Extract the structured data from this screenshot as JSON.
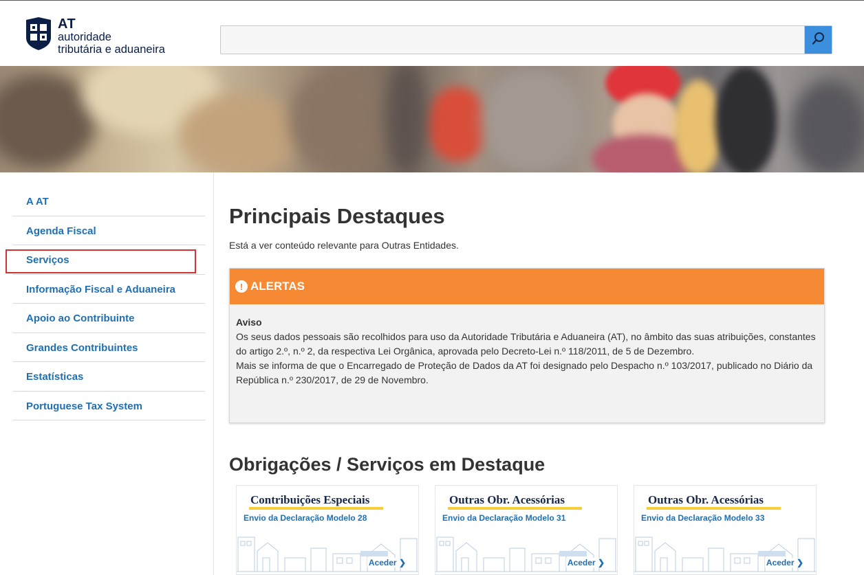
{
  "brand": {
    "logo_abbr": "AT",
    "logo_line1": "autoridade",
    "logo_line2": "tributária e aduaneira",
    "colors": {
      "primary": "#1f6fb2",
      "alert_orange": "#f68a34",
      "search_button": "#3b8fdc",
      "highlight_red": "#d23232"
    }
  },
  "search": {
    "value": "",
    "placeholder": "",
    "button_icon": "search-icon"
  },
  "sidebar": {
    "items": [
      {
        "label": "A AT"
      },
      {
        "label": "Agenda Fiscal"
      },
      {
        "label": "Serviços"
      },
      {
        "label": "Informação Fiscal e Aduaneira"
      },
      {
        "label": "Apoio ao Contribuinte"
      },
      {
        "label": "Grandes Contribuintes"
      },
      {
        "label": "Estatísticas"
      },
      {
        "label": "Portuguese Tax System"
      }
    ]
  },
  "main": {
    "title": "Principais Destaques",
    "subtitle": "Está a ver conteúdo relevante para Outras Entidades.",
    "alert": {
      "heading": "ALERTAS",
      "icon": "exclamation-icon",
      "aviso_label": "Aviso",
      "paragraph1": "Os seus dados pessoais são recolhidos para uso da Autoridade Tributária e Aduaneira (AT), no âmbito das suas atribuições, constantes do artigo 2.º, n.º 2, da respectiva Lei Orgânica, aprovada pelo Decreto-Lei n.º 118/2011, de 5 de Dezembro.",
      "paragraph2": "Mais se informa de que o Encarregado de Proteção de Dados da AT foi designado pelo Despacho n.º 103/2017, publicado no Diário da República n.º 230/2017, de 29 de Novembro."
    },
    "section_title": "Obrigações / Serviços em Destaque",
    "cards": [
      {
        "title": "Contribuições Especiais",
        "link": "Envio da Declaração Modelo 28",
        "action": "Aceder"
      },
      {
        "title": "Outras Obr. Acessórias",
        "link": "Envio da Declaração Modelo 31",
        "action": "Aceder"
      },
      {
        "title": "Outras Obr. Acessórias",
        "link": "Envio da Declaração Modelo 33",
        "action": "Aceder"
      }
    ]
  }
}
